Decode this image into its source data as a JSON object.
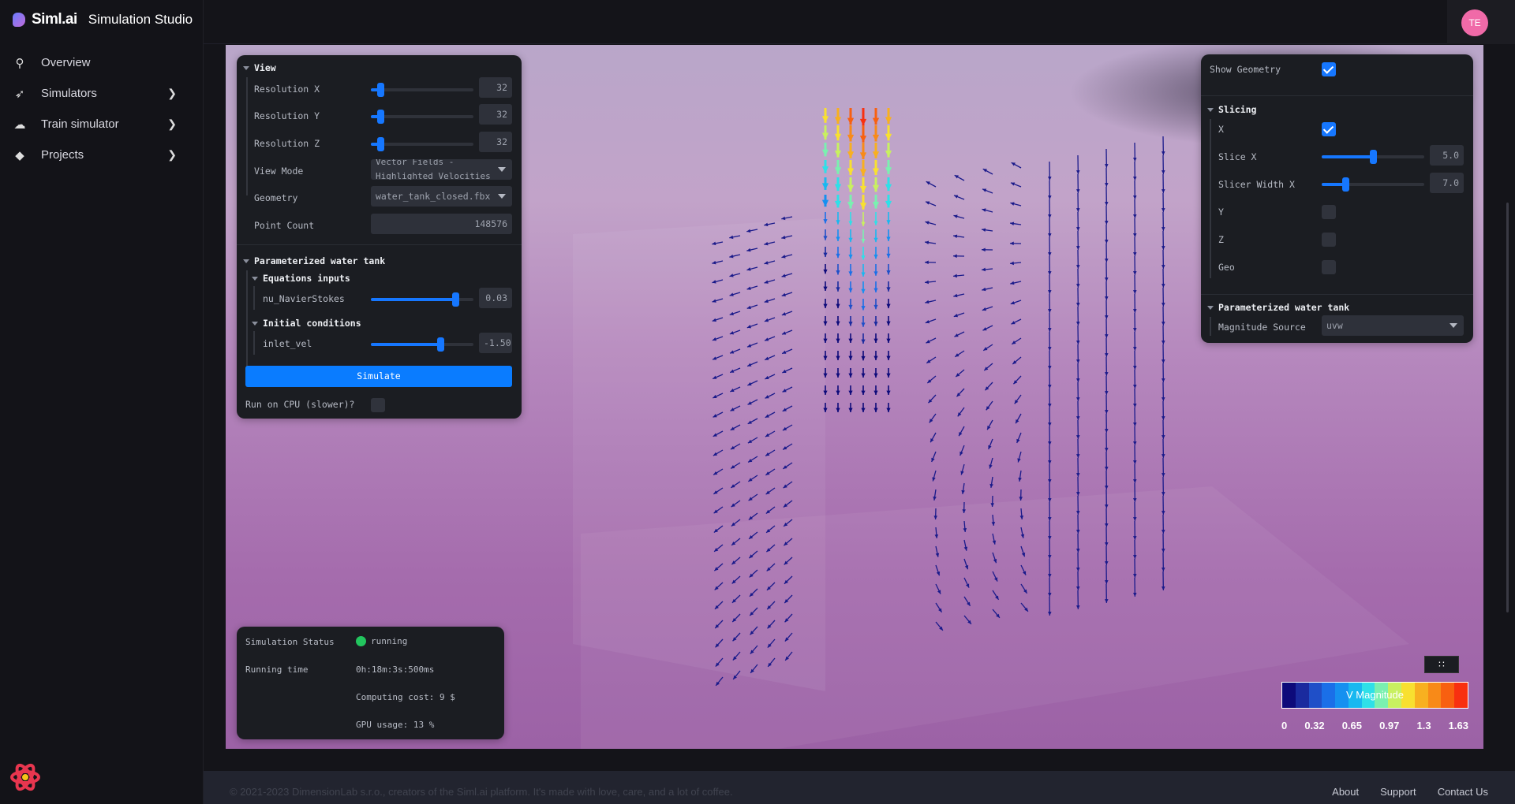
{
  "brand": {
    "name": "Siml.ai",
    "subtitle": "Simulation Studio"
  },
  "nav": [
    {
      "label": "Overview",
      "icon": "telescope-icon"
    },
    {
      "label": "Simulators",
      "icon": "rocket-icon"
    },
    {
      "label": "Train simulator",
      "icon": "cloud-upload-icon"
    },
    {
      "label": "Projects",
      "icon": "diamond-icon"
    }
  ],
  "user": {
    "initials": "TE"
  },
  "view_panel": {
    "view": {
      "title": "View",
      "res_x_label": "Resolution X",
      "res_x": "32",
      "res_y_label": "Resolution Y",
      "res_y": "32",
      "res_z_label": "Resolution Z",
      "res_z": "32",
      "view_mode_label": "View Mode",
      "view_mode": "Vector Fields - Highlighted Velocities",
      "geometry_label": "Geometry",
      "geometry": "water_tank_closed.fbx",
      "point_count_label": "Point Count",
      "point_count": "148576"
    },
    "param": {
      "title": "Parameterized water tank",
      "eq_title": "Equations inputs",
      "nu_label": "nu_NavierStokes",
      "nu_value": "0.03",
      "nu_fraction": 0.82,
      "ic_title": "Initial conditions",
      "inlet_label": "inlet_vel",
      "inlet_value": "-1.50",
      "inlet_fraction": 0.68
    },
    "simulate": "Simulate",
    "cpu_label": "Run on CPU (slower)?"
  },
  "slice_panel": {
    "show_geometry_label": "Show Geometry",
    "slicing_title": "Slicing",
    "x_label": "X",
    "slice_x_label": "Slice X",
    "slice_x": "5.0",
    "slice_x_fraction": 0.5,
    "slicer_width_label": "Slicer Width X",
    "slicer_width": "7.0",
    "slicer_width_fraction": 0.23,
    "y_label": "Y",
    "z_label": "Z",
    "geo_label": "Geo",
    "param_title": "Parameterized water tank",
    "mag_label": "Magnitude Source",
    "mag_value": "uvw"
  },
  "status": {
    "status_label": "Simulation Status",
    "status_value": "running",
    "status_color": "#22c55e",
    "time_label": "Running time",
    "time_value": "0h:18m:3s:500ms",
    "cost": "Computing cost: 9 $",
    "gpu": "GPU usage: 13 %"
  },
  "legend": {
    "title": "V Magnitude",
    "ticks": [
      "0",
      "0.32",
      "0.65",
      "0.97",
      "1.3",
      "1.63"
    ],
    "colors": [
      "#0d0a7a",
      "#1a2a9e",
      "#1f4fc8",
      "#1a6fe8",
      "#1590f0",
      "#18b8f0",
      "#2ee0e8",
      "#7af0b0",
      "#c8f060",
      "#f8e030",
      "#f8b020",
      "#f88a18",
      "#f86010",
      "#f83010"
    ]
  },
  "grid_button": "∷",
  "footer": {
    "copyright": "© 2021-2023 DimensionLab s.r.o., creators of the Siml.ai platform. It's made with love, care, and a lot of coffee.",
    "links": [
      "About",
      "Support",
      "Contact Us"
    ]
  }
}
